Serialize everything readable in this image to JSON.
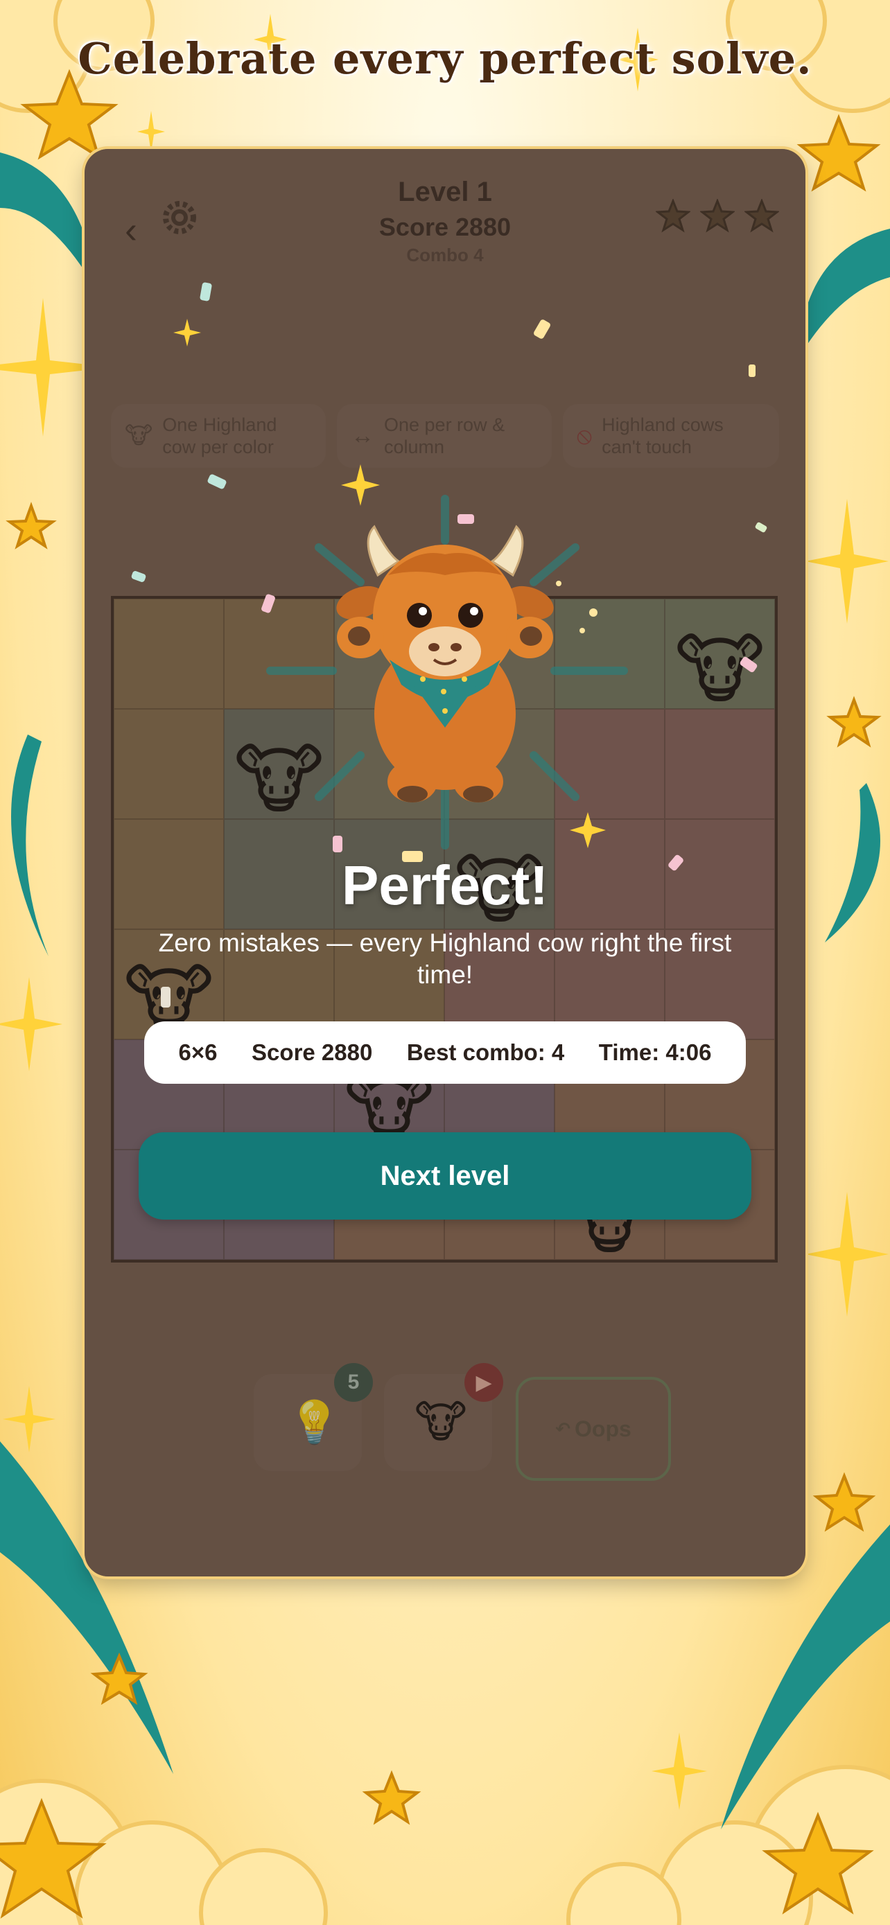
{
  "headline": "Celebrate every perfect solve.",
  "header": {
    "level": "Level 1",
    "score": "Score 2880",
    "combo": "Combo 4",
    "stars_earned": 3,
    "stars_total": 3
  },
  "rules": [
    {
      "icon": "cow-icon",
      "label": "One Highland cow per color"
    },
    {
      "icon": "arrows-horizontal-icon",
      "label": "One per row & column"
    },
    {
      "icon": "no-entry-icon",
      "label": "Highland cows can't touch"
    }
  ],
  "board": {
    "rows": 6,
    "cols": 6
  },
  "tools": {
    "hint_count": "5",
    "oops_label": "Oops"
  },
  "celebration": {
    "title": "Perfect!",
    "message": "Zero mistakes — every Highland cow right the first time!",
    "stats": {
      "size": "6×6",
      "score": "Score 2880",
      "best_combo": "Best combo: 4",
      "time": "Time: 4:06"
    },
    "next_button": "Next level"
  },
  "colors": {
    "accent": "#147a78",
    "card_bg": "#6b5548",
    "headline": "#4a2a12"
  }
}
